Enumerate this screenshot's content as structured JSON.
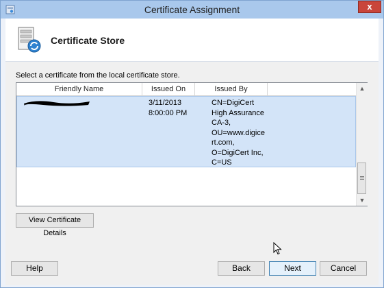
{
  "window": {
    "title": "Certificate Assignment",
    "close_glyph": "x"
  },
  "header": {
    "title": "Certificate Store",
    "icon": "certificate-store-icon"
  },
  "instruction": "Select a certificate from the local certificate store.",
  "list": {
    "columns": [
      "Friendly Name",
      "Issued On",
      "Issued By"
    ],
    "rows": [
      {
        "friendly_name_redacted": true,
        "issued_on": [
          "3/11/2013",
          "8:00:00 PM"
        ],
        "issued_by": [
          "CN=DigiCert",
          "High Assurance",
          "CA-3,",
          "OU=www.digice",
          "rt.com,",
          "O=DigiCert Inc,",
          "C=US"
        ]
      }
    ],
    "scroll_up": "▲",
    "scroll_down": "▼"
  },
  "buttons": {
    "view_details": "View Certificate Details",
    "help": "Help",
    "back": "Back",
    "next": "Next",
    "cancel": "Cancel"
  },
  "colors": {
    "titlebar": "#a9c8ec",
    "selected_row": "#d3e4f8",
    "close": "#c9453b"
  }
}
